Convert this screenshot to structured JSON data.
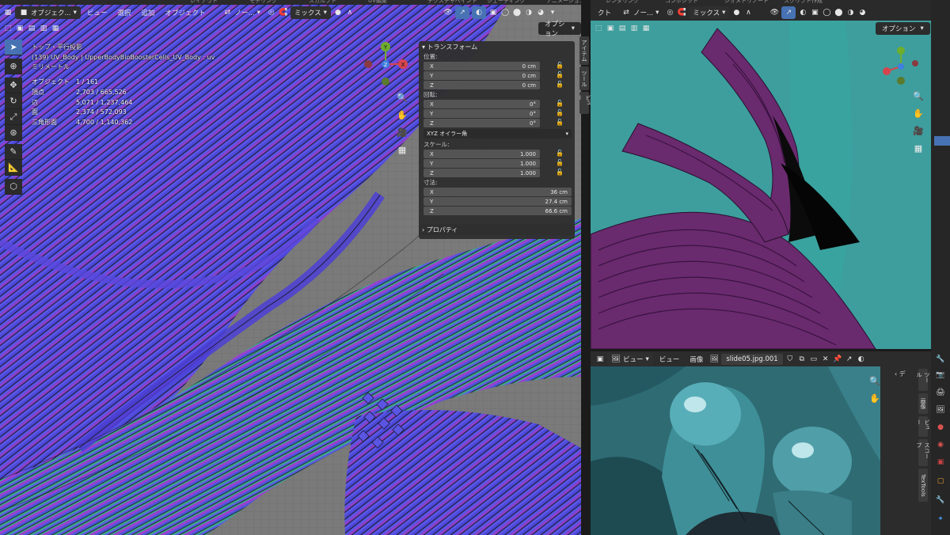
{
  "top_tabs": [
    "レイアウト",
    "モデリング",
    "スカルプト",
    "UV編集",
    "テクスチャペイント",
    "シェーディング",
    "アニメーション",
    "レンダリング",
    "コンポジット",
    "ジオメトリノード",
    "スクリプト作成"
  ],
  "left_header": {
    "mode_label": "オブジェク...",
    "menus": [
      "ビュー",
      "選択",
      "追加",
      "オブジェクト"
    ],
    "orientation": "ノー...",
    "shading_mix": "ミックス",
    "options_label": "オプション"
  },
  "viewport_overlay": {
    "view_name": "トップ・平行投影",
    "object_line": "(139) UV_Body | UpperBodyBioBoosterCells_UV_Body : uv",
    "units": "ミリメートル",
    "stats": [
      {
        "label": "オブジェクト",
        "value": "1 / 161"
      },
      {
        "label": "頂点",
        "value": "2,703 / 665,526"
      },
      {
        "label": "辺",
        "value": "5,071 / 1,237,464"
      },
      {
        "label": "面",
        "value": "2,374 / 572,093"
      },
      {
        "label": "三角形面",
        "value": "4,700 / 1,140,362"
      }
    ]
  },
  "gizmo": {
    "x": "X",
    "y": "Y",
    "z": "Z"
  },
  "transform_panel": {
    "title": "トランスフォーム",
    "location_label": "位置:",
    "location": [
      {
        "axis": "X",
        "value": "0 cm"
      },
      {
        "axis": "Y",
        "value": "0 cm"
      },
      {
        "axis": "Z",
        "value": "0 cm"
      }
    ],
    "rotation_label": "回転:",
    "rotation": [
      {
        "axis": "X",
        "value": "0°"
      },
      {
        "axis": "Y",
        "value": "0°"
      },
      {
        "axis": "Z",
        "value": "0°"
      }
    ],
    "rotation_mode": "XYZ オイラー角",
    "scale_label": "スケール:",
    "scale": [
      {
        "axis": "X",
        "value": "1.000"
      },
      {
        "axis": "Y",
        "value": "1.000"
      },
      {
        "axis": "Z",
        "value": "1.000"
      }
    ],
    "dimensions_label": "寸法:",
    "dimensions": [
      {
        "axis": "X",
        "value": "36 cm"
      },
      {
        "axis": "Y",
        "value": "27.4 cm"
      },
      {
        "axis": "Z",
        "value": "66.6 cm"
      }
    ],
    "properties_label": "プロパティ"
  },
  "side_tabs": [
    "アイテム",
    "ツール",
    "ビュー"
  ],
  "right_header": {
    "partial_label": "クト",
    "orientation": "ノー...",
    "shading_mix": "ミックス",
    "options_label": "オプション"
  },
  "image_editor": {
    "view_label": "ビュー",
    "menus": [
      "ビュー",
      "画像"
    ],
    "filename": "slide05.jpg.001",
    "side_tabs": [
      "ツール",
      "画像",
      "ビュー",
      "スコープ",
      "TexTools"
    ],
    "partial_tab": "デ"
  },
  "colors": {
    "accent": "#4772b3",
    "teal": "#3a9b9a",
    "purple": "#6a2a6e",
    "stripe_blue": "#5552e0",
    "stripe_purple": "#8d3ec8",
    "stripe_green": "#3fa88a"
  }
}
